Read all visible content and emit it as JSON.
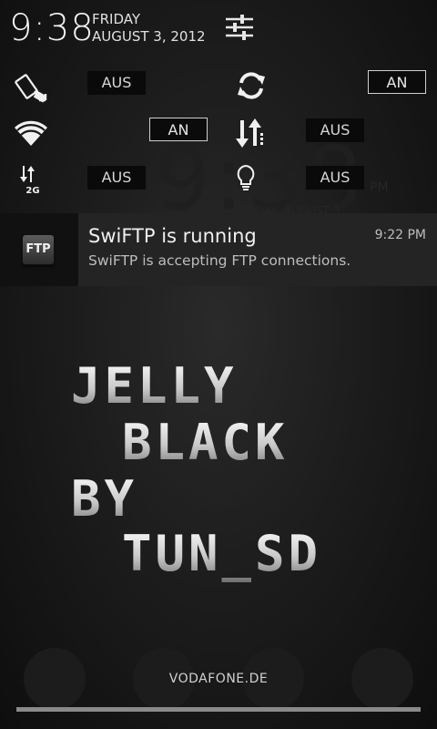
{
  "status": {
    "time": "9:38",
    "day": "FRIDAY",
    "date": "AUGUST 3, 2012"
  },
  "background": {
    "clock": "9:38",
    "pm": "PM",
    "date": "FRIDAY, AUGUST 3"
  },
  "toggles": [
    {
      "icon": "auto-rotate-icon",
      "state": "AUS"
    },
    {
      "icon": "sync-icon",
      "state": "AN"
    },
    {
      "icon": "wifi-icon",
      "state": "AN"
    },
    {
      "icon": "mobile-data-icon",
      "state": "AUS"
    },
    {
      "icon": "2g-network-icon",
      "state": "AUS"
    },
    {
      "icon": "flashlight-icon",
      "state": "AUS"
    }
  ],
  "notification": {
    "icon_label": "FTP",
    "title": "SwiFTP is running",
    "time": "9:22 PM",
    "text": "SwiFTP is accepting FTP connections."
  },
  "logo": {
    "lines": [
      "JELLY",
      "BLACK",
      "BY",
      "TUN_SD"
    ]
  },
  "footer": {
    "carrier": "VODAFONE.DE"
  },
  "colors": {
    "background": "#161616",
    "notification_bg": "#242424",
    "pill_bg": "#0a0a0a"
  }
}
